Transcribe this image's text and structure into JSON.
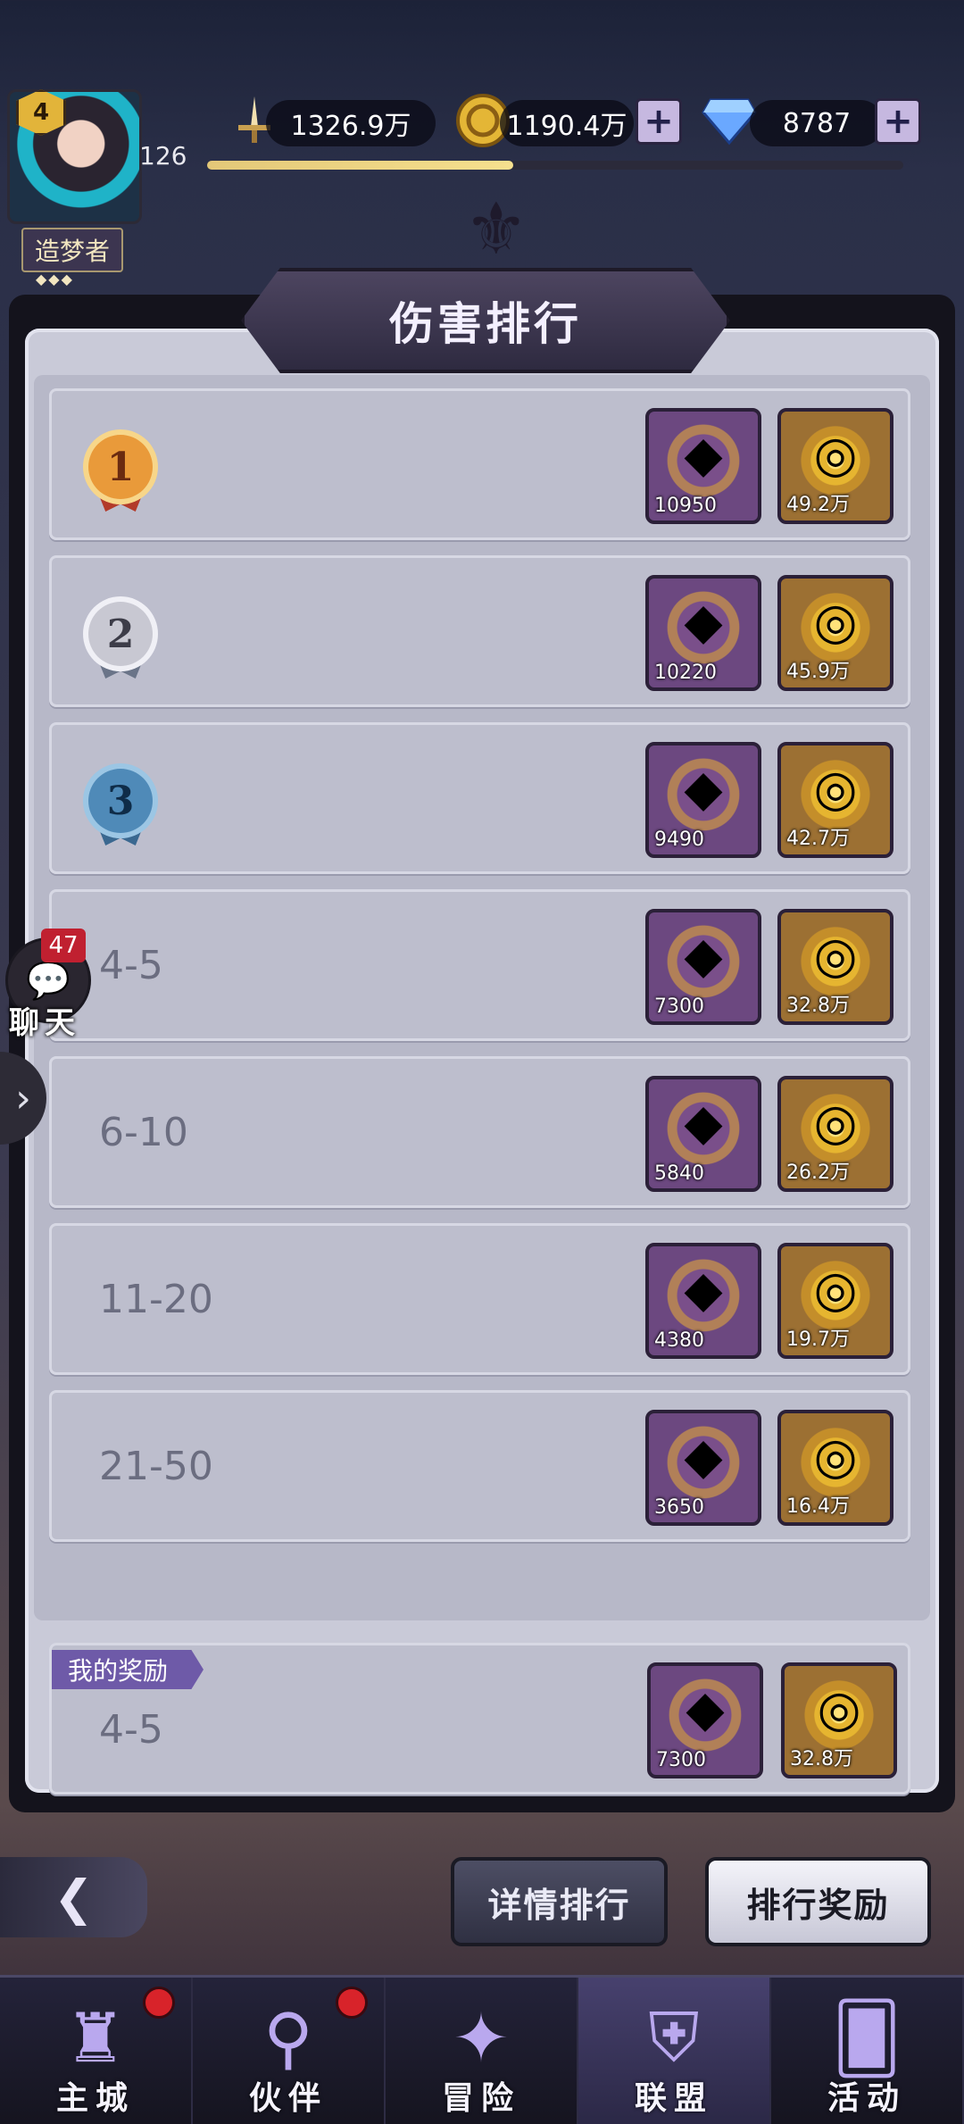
{
  "player": {
    "level": "4",
    "exp_value": "126",
    "title": "造梦者",
    "title_stars": "◆◆◆",
    "exp_progress": 0.44
  },
  "resources": {
    "power": "1326.9万",
    "gold": "1190.4万",
    "diamond": "8787",
    "plus": "+"
  },
  "panel": {
    "title": "伤害排行"
  },
  "ranks": [
    {
      "label": "1",
      "type": "medal",
      "medal_color": "gold",
      "gem": "10950",
      "gold": "49.2万"
    },
    {
      "label": "2",
      "type": "medal",
      "medal_color": "silver",
      "gem": "10220",
      "gold": "45.9万"
    },
    {
      "label": "3",
      "type": "medal",
      "medal_color": "blue",
      "gem": "9490",
      "gold": "42.7万"
    },
    {
      "label": "4-5",
      "type": "text",
      "gem": "7300",
      "gold": "32.8万"
    },
    {
      "label": "6-10",
      "type": "text",
      "gem": "5840",
      "gold": "26.2万"
    },
    {
      "label": "11-20",
      "type": "text",
      "gem": "4380",
      "gold": "19.7万"
    },
    {
      "label": "21-50",
      "type": "text",
      "gem": "3650",
      "gold": "16.4万"
    }
  ],
  "my_reward": {
    "tag": "我的奖励",
    "rank": "4-5",
    "gem": "7300",
    "gold": "32.8万"
  },
  "chat": {
    "badge": "47",
    "label": "聊天"
  },
  "buttons": {
    "detail": "详情排行",
    "reward": "排行奖励"
  },
  "nav": [
    {
      "label": "主城",
      "icon": "castle-icon",
      "dot": true
    },
    {
      "label": "伙伴",
      "icon": "wizard-hat-icon",
      "dot": true
    },
    {
      "label": "冒险",
      "icon": "compass-icon",
      "dot": false
    },
    {
      "label": "联盟",
      "icon": "shield-icon",
      "dot": false,
      "active": true
    },
    {
      "label": "活动",
      "icon": "cards-icon",
      "dot": false
    }
  ]
}
